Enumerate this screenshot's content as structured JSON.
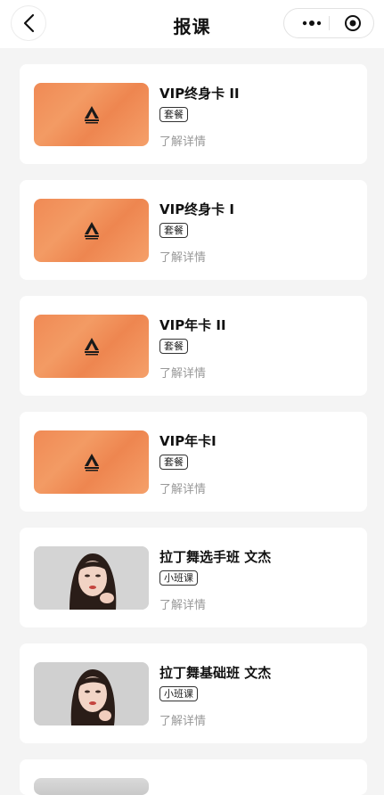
{
  "nav": {
    "title": "报课"
  },
  "courses": [
    {
      "title": "VIP终身卡 II",
      "tag": "套餐",
      "detail": "了解详情",
      "thumb": "orange-brand-logo"
    },
    {
      "title": "VIP终身卡 I",
      "tag": "套餐",
      "detail": "了解详情",
      "thumb": "orange-brand-logo"
    },
    {
      "title": "VIP年卡 II",
      "tag": "套餐",
      "detail": "了解详情",
      "thumb": "orange-brand-logo"
    },
    {
      "title": "VIP年卡I",
      "tag": "套餐",
      "detail": "了解详情",
      "thumb": "orange-brand-logo"
    },
    {
      "title": "拉丁舞选手班 文杰",
      "tag": "小班课",
      "detail": "了解详情",
      "thumb": "instructor-photo"
    },
    {
      "title": "拉丁舞基础班 文杰",
      "tag": "小班课",
      "detail": "了解详情",
      "thumb": "instructor-photo"
    }
  ],
  "colors": {
    "accent": "#f08a55",
    "background": "#f4f4f4"
  }
}
